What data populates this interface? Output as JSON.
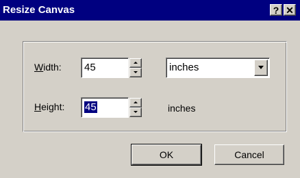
{
  "window": {
    "title": "Resize Canvas",
    "help_label": "?",
    "close_label": "✕"
  },
  "width_row": {
    "label_prefix": "",
    "label_accel": "W",
    "label_rest": "idth:",
    "value": "45",
    "units_selected": "inches"
  },
  "height_row": {
    "label_accel": "H",
    "label_rest": "eight:",
    "value": "45",
    "units_text": "inches"
  },
  "buttons": {
    "ok": "OK",
    "cancel": "Cancel"
  },
  "colors": {
    "titlebar": "#000080",
    "face": "#d4d0c8",
    "selection": "#000080"
  }
}
